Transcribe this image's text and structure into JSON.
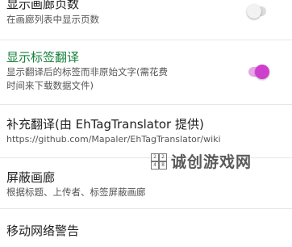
{
  "settings": {
    "show_page_count": {
      "title": "显示画廊页数",
      "subtitle": "在画廊列表中显示页数",
      "enabled": false
    },
    "show_tag_translation": {
      "title": "显示标签翻译",
      "subtitle_line1": "显示翻译后的标签而非原始文字(需花费",
      "subtitle_line2": "时间来下载数据文件)",
      "enabled": true
    },
    "supplementary_translation": {
      "title": "补充翻译(由 EhTagTranslator 提供)",
      "subtitle": "https://github.com/Mapaler/EhTagTranslator/wiki"
    },
    "block_gallery": {
      "title": "屏蔽画廊",
      "subtitle": "根据标题、上传者、标签屏蔽画廊"
    },
    "mobile_network_warning": {
      "title": "移动网络警告"
    }
  },
  "watermark": {
    "text": "诚创游戏网",
    "icon_glyphs": [
      "2",
      "2",
      "4",
      "8"
    ]
  },
  "colors": {
    "accent_green": "#16803a",
    "toggle_on": "#cf3fce",
    "toggle_off": "#f2f2f2"
  }
}
